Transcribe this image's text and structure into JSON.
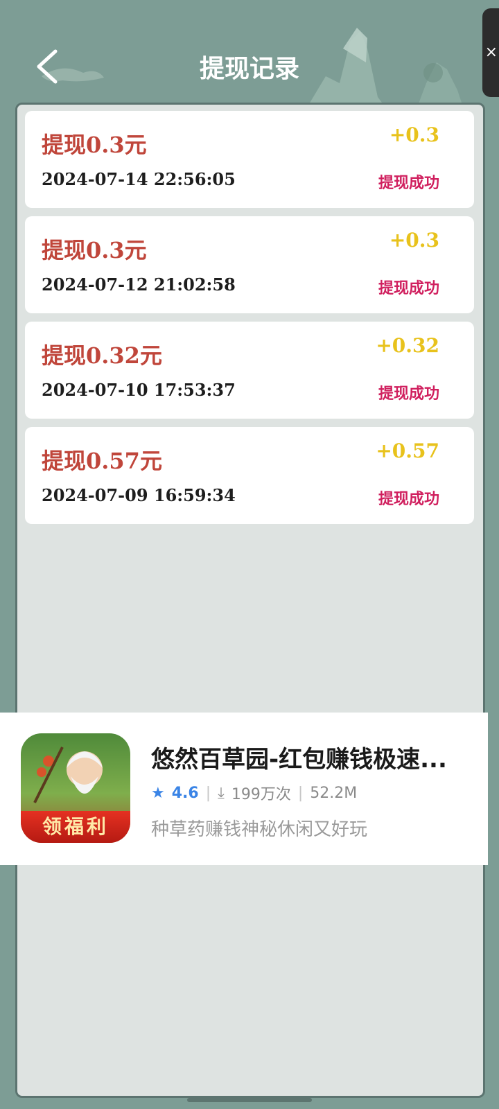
{
  "header": {
    "title": "提现记录"
  },
  "records": [
    {
      "title": "提现0.3元",
      "amount": "+0.3",
      "time": "2024-07-14 22:56:05",
      "status": "提现成功"
    },
    {
      "title": "提现0.3元",
      "amount": "+0.3",
      "time": "2024-07-12 21:02:58",
      "status": "提现成功"
    },
    {
      "title": "提现0.32元",
      "amount": "+0.32",
      "time": "2024-07-10 17:53:37",
      "status": "提现成功"
    },
    {
      "title": "提现0.57元",
      "amount": "+0.57",
      "time": "2024-07-09 16:59:34",
      "status": "提现成功"
    }
  ],
  "ad": {
    "title": "悠然百草园-红包赚钱极速...",
    "rating": "4.6",
    "downloads": "199万次",
    "size": "52.2M",
    "description": "种草药赚钱神秘休闲又好玩",
    "badge": "领福利"
  },
  "colors": {
    "background": "#7d9d95",
    "title_red": "#c0463b",
    "amount_gold": "#e8c21c",
    "status_pink": "#d01f5e",
    "rating_blue": "#3a84e6"
  },
  "icons": {
    "back": "back-arrow-icon",
    "close": "close-icon",
    "star": "star-icon",
    "download": "download-icon"
  }
}
